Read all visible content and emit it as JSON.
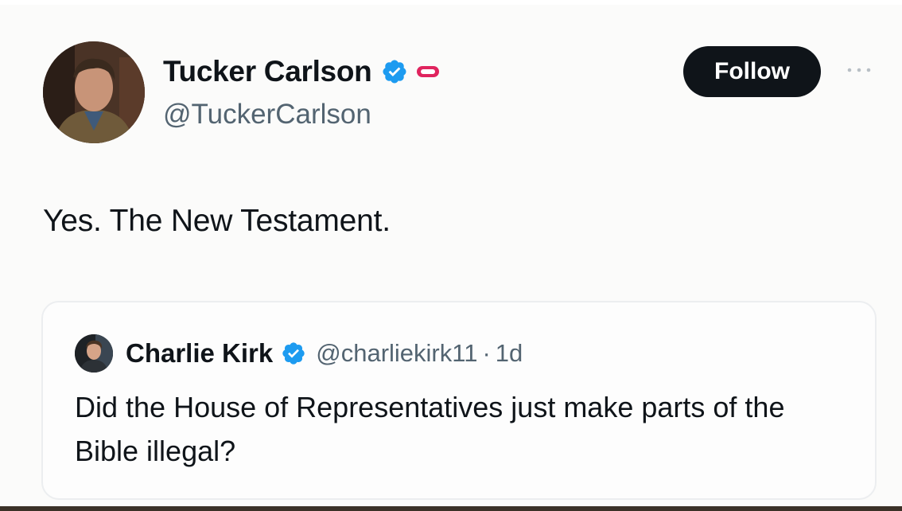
{
  "tweet": {
    "author": {
      "display_name": "Tucker Carlson",
      "handle": "@TuckerCarlson",
      "verified_icon": "verified-badge-icon",
      "affiliation_icon": "affiliation-badge-icon"
    },
    "follow_label": "Follow",
    "text": "Yes. The New Testament.",
    "colors": {
      "verified": "#1d9bf0",
      "follow_bg": "#0f1419",
      "follow_text": "#ffffff",
      "affiliation": "#e0245e",
      "secondary_text": "#536471"
    }
  },
  "quoted_tweet": {
    "author": {
      "display_name": "Charlie Kirk",
      "handle": "@charliekirk11"
    },
    "separator": "·",
    "timestamp": "1d",
    "text": "Did the House of Representatives just make parts of the Bible illegal?"
  }
}
